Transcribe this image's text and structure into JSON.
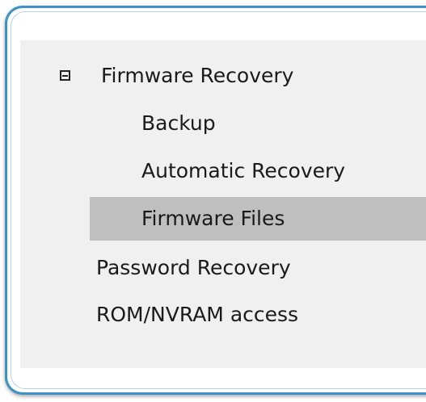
{
  "tree": {
    "firmware_recovery": {
      "label": "Firmware Recovery",
      "expanded": true,
      "expander_icon": "minus-box-icon",
      "children": [
        {
          "label": "Backup"
        },
        {
          "label": "Automatic Recovery"
        },
        {
          "label": "Firmware Files",
          "selected": true
        }
      ]
    },
    "password_recovery": {
      "label": "Password Recovery"
    },
    "rom_nvram_access": {
      "label": "ROM/NVRAM access"
    }
  },
  "colors": {
    "frame_border": "#3d93c6",
    "panel_background": "#f0f0f0",
    "selection": "#bfbfbf",
    "text": "#1a1a1a"
  }
}
